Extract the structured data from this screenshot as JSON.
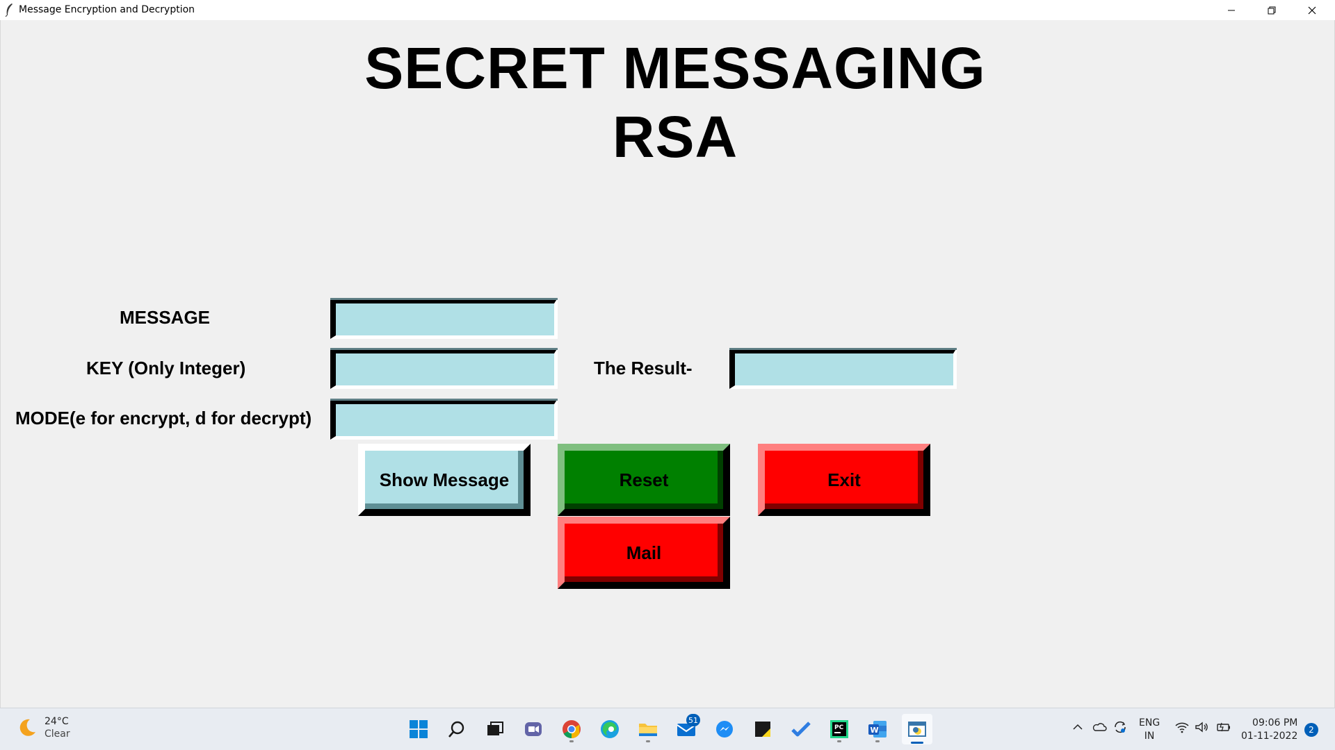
{
  "window": {
    "title": "Message Encryption and Decryption",
    "minimize_icon": "minimize-icon",
    "maximize_icon": "restore-icon",
    "close_icon": "close-icon"
  },
  "app": {
    "heading_line1": "SECRET MESSAGING",
    "heading_line2": "RSA",
    "message_label": "MESSAGE",
    "key_label": "KEY (Only Integer)",
    "mode_label": "MODE(e for encrypt, d for decrypt)",
    "result_label": "The Result-",
    "message_value": "",
    "key_value": "",
    "mode_value": "",
    "result_value": "",
    "buttons": {
      "show": "Show Message",
      "reset": "Reset",
      "exit": "Exit",
      "mail": "Mail"
    },
    "colors": {
      "entry_bg": "#b0e0e6",
      "show_bg": "#b0e0e6",
      "reset_bg": "#008000",
      "exit_bg": "#ff0000",
      "mail_bg": "#ff0000"
    }
  },
  "taskbar": {
    "weather_temp": "24°C",
    "weather_condition": "Clear",
    "mail_badge": "51",
    "language": "ENG",
    "region": "IN",
    "time": "09:06 PM",
    "date": "01-11-2022",
    "notifications": "2",
    "icons": [
      "windows-start-icon",
      "search-icon",
      "task-view-icon",
      "teams-chat-icon",
      "chrome-icon",
      "edge-icon",
      "file-explorer-icon",
      "mail-icon",
      "messenger-icon",
      "sticky-notes-icon",
      "todo-icon",
      "pycharm-icon",
      "word-icon",
      "python-tk-icon"
    ]
  }
}
